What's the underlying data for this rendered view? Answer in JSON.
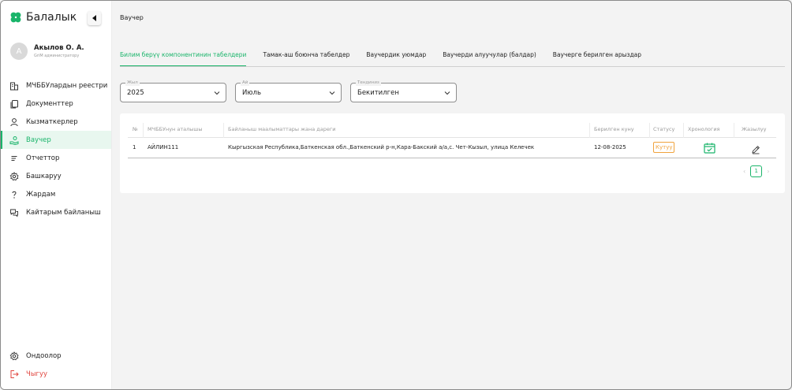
{
  "app": {
    "name": "Балалык"
  },
  "user": {
    "initial": "А",
    "name": "Акылов О. А.",
    "role": "GriM администратору"
  },
  "sidebar": {
    "items": [
      {
        "label": "МЧББУлардын реестри",
        "icon": "building-icon"
      },
      {
        "label": "Документтер",
        "icon": "documents-icon"
      },
      {
        "label": "Кызматкерлер",
        "icon": "user-icon"
      },
      {
        "label": "Ваучер",
        "icon": "voucher-hand-icon"
      },
      {
        "label": "Отчеттор",
        "icon": "list-icon"
      },
      {
        "label": "Башкаруу",
        "icon": "gear-icon"
      },
      {
        "label": "Жардам",
        "icon": "question-icon"
      },
      {
        "label": "Кайтарым байланыш",
        "icon": "chat-icon"
      }
    ],
    "active_index": 3,
    "settings_label": "Ондоолор",
    "logout_label": "Чыгуу"
  },
  "page": {
    "title": "Ваучер"
  },
  "tabs": [
    "Билим берүү компонентинин табелдери",
    "Тамак-аш боюнча табелдер",
    "Ваучердик уюмдар",
    "Ваучерди алуучулар (балдар)",
    "Ваучерге берилген арыздар"
  ],
  "filters": {
    "year": {
      "label": "Жыл",
      "value": "2025"
    },
    "month": {
      "label": "Ай",
      "value": "Июль"
    },
    "status": {
      "label": "Тендиниз",
      "value": "Бекитилген"
    }
  },
  "table": {
    "headers": [
      "№",
      "МЧББУнун аталышы",
      "Байланыш маалыматтары жана дареги",
      "Берилген куну",
      "Статусу",
      "Хронология",
      "Жазылуу"
    ],
    "rows": [
      {
        "num": "1",
        "name": "АЙЛИН111",
        "address": "Кыргызская Республика,Баткенская обл.,Баткенский р-н,Кара-Бакский а/а,с. Чет-Кызыл, улица Келечек",
        "date": "12-08-2025",
        "status": "Кутуу"
      }
    ]
  },
  "pagination": {
    "current": "1"
  },
  "colors": {
    "accent": "#19b46a",
    "pending": "#f0a23c",
    "logout": "#e0463f"
  }
}
